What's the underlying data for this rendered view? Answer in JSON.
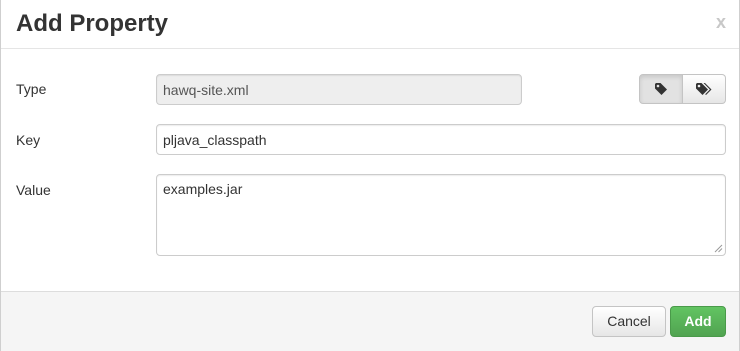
{
  "dialog": {
    "title": "Add Property",
    "close_glyph": "x"
  },
  "form": {
    "type": {
      "label": "Type",
      "value": "hawq-site.xml",
      "readonly": true,
      "toggle": {
        "left_icon": "tag-icon",
        "right_icon": "tags-icon",
        "selected": "left"
      }
    },
    "key": {
      "label": "Key",
      "value": "pljava_classpath"
    },
    "value": {
      "label": "Value",
      "value": "examples.jar"
    }
  },
  "footer": {
    "cancel_label": "Cancel",
    "add_label": "Add"
  },
  "colors": {
    "add_button": "#5bb75b",
    "footer_bg": "#f5f5f5",
    "readonly_bg": "#eeeeee"
  }
}
